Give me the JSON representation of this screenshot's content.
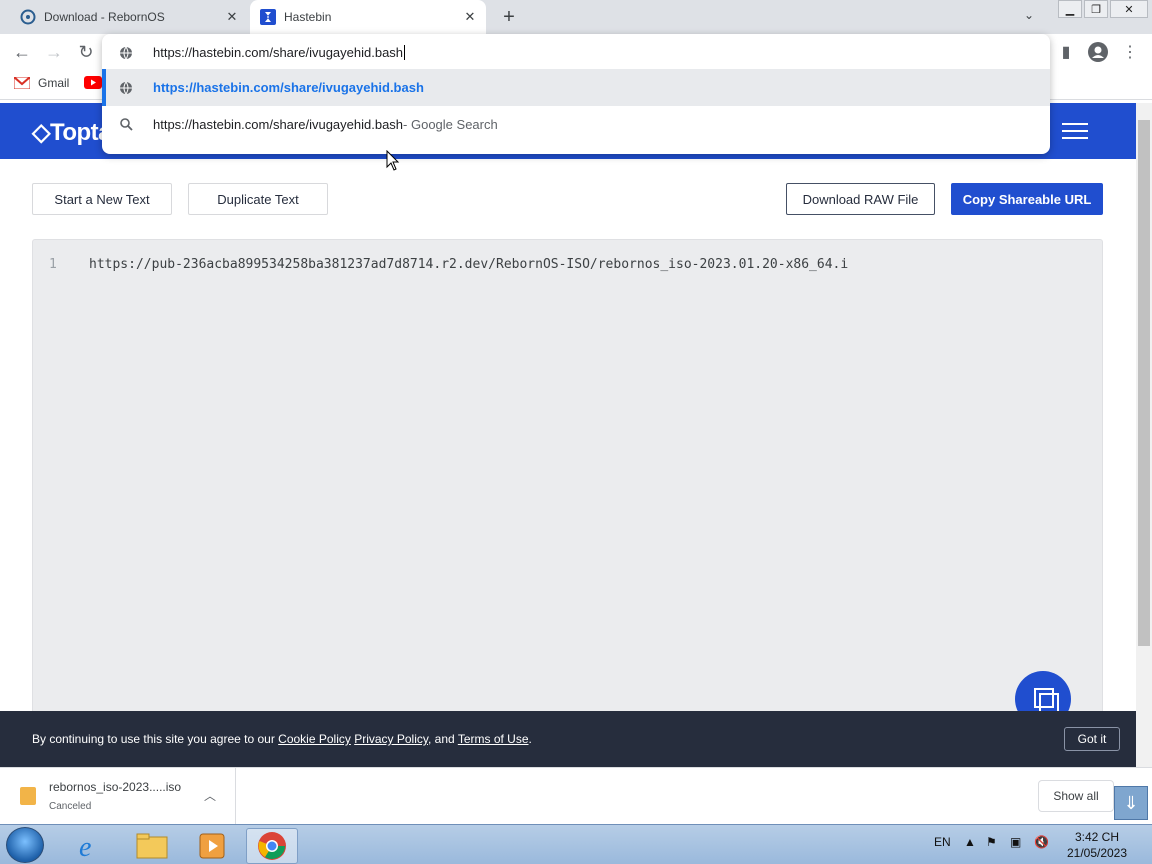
{
  "browser": {
    "tabs": [
      {
        "title": "Download - RebornOS",
        "active": false
      },
      {
        "title": "Hastebin",
        "active": true
      }
    ],
    "new_tab_label": "+",
    "omnibox": {
      "value": "https://hastebin.com/share/ivugayehid.bash",
      "suggestions": [
        {
          "text": "https://hastebin.com/share/ivugayehid.bash",
          "suffix": "",
          "icon": "globe-icon",
          "selected": true
        },
        {
          "text": "https://hastebin.com/share/ivugayehid.bash",
          "suffix": " - Google Search",
          "icon": "search-icon",
          "selected": false
        }
      ]
    },
    "bookmarks": [
      {
        "label": "Gmail",
        "icon": "gmail-icon"
      },
      {
        "label": "",
        "icon": "youtube-icon"
      }
    ]
  },
  "site": {
    "logo": "Toptal",
    "accent_color": "#204ecf",
    "buttons": {
      "new_text": "Start a New Text",
      "duplicate": "Duplicate Text",
      "download_raw": "Download RAW File",
      "copy_url": "Copy Shareable URL"
    },
    "editor": {
      "line_number": "1",
      "line_text": "https://pub-236acba899534258ba381237ad7d8714.r2.dev/RebornOS-ISO/rebornos_iso-2023.01.20-x86_64.i"
    },
    "cookie": {
      "prefix": "By continuing to use this site you agree to our ",
      "cookie_policy": "Cookie Policy",
      "privacy_policy": "Privacy Policy",
      "and": ", and ",
      "terms": "Terms of Use",
      "suffix": ".",
      "button": "Got it"
    }
  },
  "downloads": {
    "item_name": "rebornos_iso-2023.....iso",
    "item_status": "Canceled",
    "show_all": "Show all"
  },
  "taskbar": {
    "language": "EN",
    "time": "3:42 CH",
    "date": "21/05/2023"
  }
}
